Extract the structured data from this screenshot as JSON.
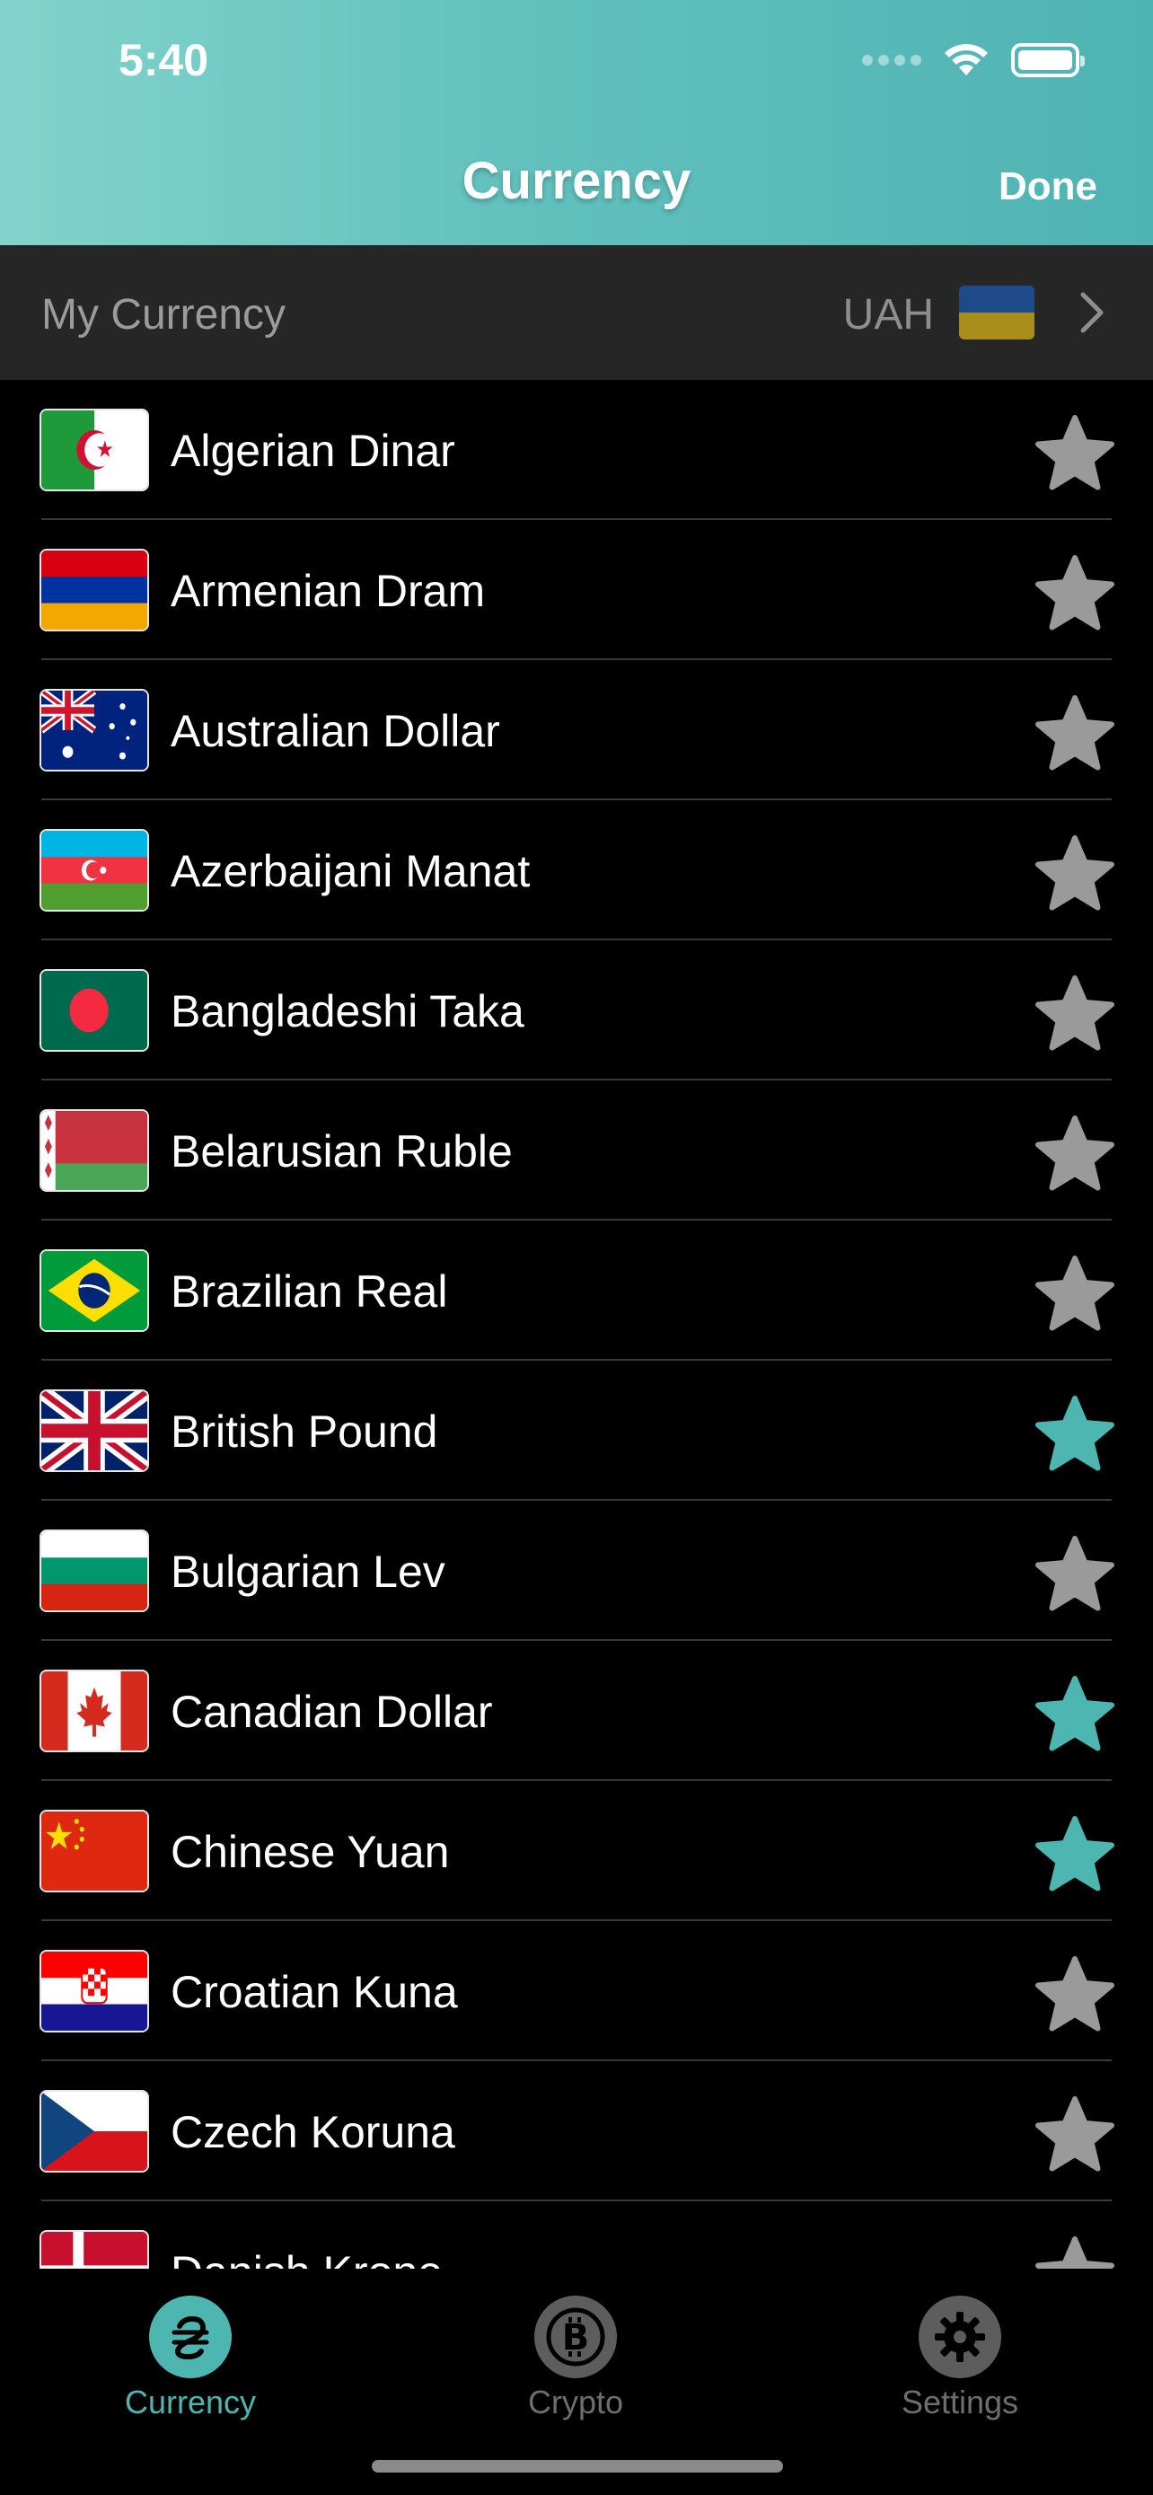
{
  "status_bar": {
    "time": "5:40"
  },
  "nav": {
    "title": "Currency",
    "done_label": "Done"
  },
  "my_currency": {
    "label": "My Currency",
    "code": "UAH",
    "flag_colors": [
      "#1f4a8a",
      "#a88d1a"
    ]
  },
  "colors": {
    "accent": "#4db6b1",
    "star_inactive": "#9a9a9a",
    "star_active": "#4db6b1"
  },
  "currencies": [
    {
      "name": "Algerian Dinar",
      "flag": "dz",
      "favorite": false
    },
    {
      "name": "Armenian Dram",
      "flag": "am",
      "favorite": false
    },
    {
      "name": "Australian Dollar",
      "flag": "au",
      "favorite": false
    },
    {
      "name": "Azerbaijani Manat",
      "flag": "az",
      "favorite": false
    },
    {
      "name": "Bangladeshi Taka",
      "flag": "bd",
      "favorite": false
    },
    {
      "name": "Belarusian Ruble",
      "flag": "by",
      "favorite": false
    },
    {
      "name": "Brazilian Real",
      "flag": "br",
      "favorite": false
    },
    {
      "name": "British Pound",
      "flag": "gb",
      "favorite": true
    },
    {
      "name": "Bulgarian Lev",
      "flag": "bg",
      "favorite": false
    },
    {
      "name": "Canadian Dollar",
      "flag": "ca",
      "favorite": true
    },
    {
      "name": "Chinese Yuan",
      "flag": "cn",
      "favorite": true
    },
    {
      "name": "Croatian Kuna",
      "flag": "hr",
      "favorite": false
    },
    {
      "name": "Czech Koruna",
      "flag": "cz",
      "favorite": false
    },
    {
      "name": "Danish Krone",
      "flag": "dk",
      "favorite": false
    }
  ],
  "tabs": [
    {
      "label": "Currency",
      "icon": "hryvnia-icon",
      "active": true
    },
    {
      "label": "Crypto",
      "icon": "bitcoin-icon",
      "active": false
    },
    {
      "label": "Settings",
      "icon": "gear-icon",
      "active": false
    }
  ]
}
